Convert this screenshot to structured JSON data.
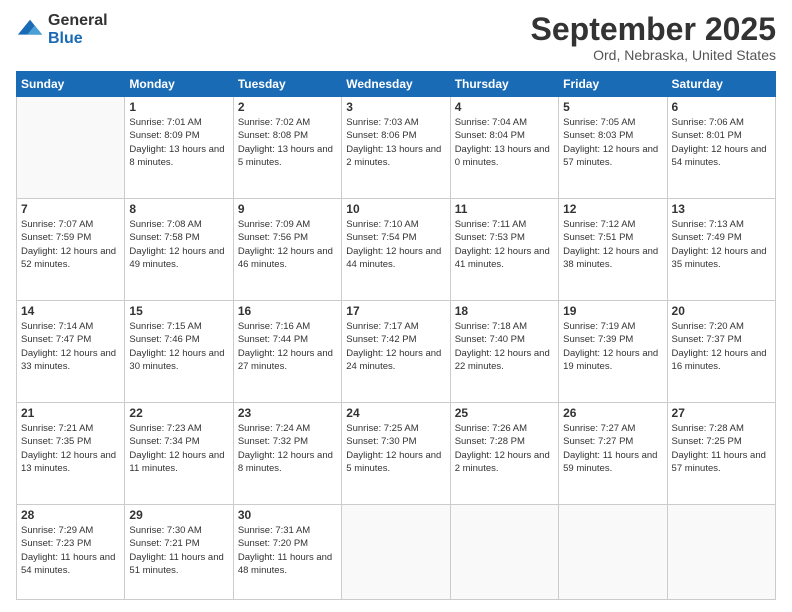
{
  "logo": {
    "general": "General",
    "blue": "Blue"
  },
  "header": {
    "title": "September 2025",
    "subtitle": "Ord, Nebraska, United States"
  },
  "weekdays": [
    "Sunday",
    "Monday",
    "Tuesday",
    "Wednesday",
    "Thursday",
    "Friday",
    "Saturday"
  ],
  "weeks": [
    [
      null,
      {
        "day": 1,
        "sunrise": "7:01 AM",
        "sunset": "8:09 PM",
        "daylight": "13 hours and 8 minutes."
      },
      {
        "day": 2,
        "sunrise": "7:02 AM",
        "sunset": "8:08 PM",
        "daylight": "13 hours and 5 minutes."
      },
      {
        "day": 3,
        "sunrise": "7:03 AM",
        "sunset": "8:06 PM",
        "daylight": "13 hours and 2 minutes."
      },
      {
        "day": 4,
        "sunrise": "7:04 AM",
        "sunset": "8:04 PM",
        "daylight": "13 hours and 0 minutes."
      },
      {
        "day": 5,
        "sunrise": "7:05 AM",
        "sunset": "8:03 PM",
        "daylight": "12 hours and 57 minutes."
      },
      {
        "day": 6,
        "sunrise": "7:06 AM",
        "sunset": "8:01 PM",
        "daylight": "12 hours and 54 minutes."
      }
    ],
    [
      {
        "day": 7,
        "sunrise": "7:07 AM",
        "sunset": "7:59 PM",
        "daylight": "12 hours and 52 minutes."
      },
      {
        "day": 8,
        "sunrise": "7:08 AM",
        "sunset": "7:58 PM",
        "daylight": "12 hours and 49 minutes."
      },
      {
        "day": 9,
        "sunrise": "7:09 AM",
        "sunset": "7:56 PM",
        "daylight": "12 hours and 46 minutes."
      },
      {
        "day": 10,
        "sunrise": "7:10 AM",
        "sunset": "7:54 PM",
        "daylight": "12 hours and 44 minutes."
      },
      {
        "day": 11,
        "sunrise": "7:11 AM",
        "sunset": "7:53 PM",
        "daylight": "12 hours and 41 minutes."
      },
      {
        "day": 12,
        "sunrise": "7:12 AM",
        "sunset": "7:51 PM",
        "daylight": "12 hours and 38 minutes."
      },
      {
        "day": 13,
        "sunrise": "7:13 AM",
        "sunset": "7:49 PM",
        "daylight": "12 hours and 35 minutes."
      }
    ],
    [
      {
        "day": 14,
        "sunrise": "7:14 AM",
        "sunset": "7:47 PM",
        "daylight": "12 hours and 33 minutes."
      },
      {
        "day": 15,
        "sunrise": "7:15 AM",
        "sunset": "7:46 PM",
        "daylight": "12 hours and 30 minutes."
      },
      {
        "day": 16,
        "sunrise": "7:16 AM",
        "sunset": "7:44 PM",
        "daylight": "12 hours and 27 minutes."
      },
      {
        "day": 17,
        "sunrise": "7:17 AM",
        "sunset": "7:42 PM",
        "daylight": "12 hours and 24 minutes."
      },
      {
        "day": 18,
        "sunrise": "7:18 AM",
        "sunset": "7:40 PM",
        "daylight": "12 hours and 22 minutes."
      },
      {
        "day": 19,
        "sunrise": "7:19 AM",
        "sunset": "7:39 PM",
        "daylight": "12 hours and 19 minutes."
      },
      {
        "day": 20,
        "sunrise": "7:20 AM",
        "sunset": "7:37 PM",
        "daylight": "12 hours and 16 minutes."
      }
    ],
    [
      {
        "day": 21,
        "sunrise": "7:21 AM",
        "sunset": "7:35 PM",
        "daylight": "12 hours and 13 minutes."
      },
      {
        "day": 22,
        "sunrise": "7:23 AM",
        "sunset": "7:34 PM",
        "daylight": "12 hours and 11 minutes."
      },
      {
        "day": 23,
        "sunrise": "7:24 AM",
        "sunset": "7:32 PM",
        "daylight": "12 hours and 8 minutes."
      },
      {
        "day": 24,
        "sunrise": "7:25 AM",
        "sunset": "7:30 PM",
        "daylight": "12 hours and 5 minutes."
      },
      {
        "day": 25,
        "sunrise": "7:26 AM",
        "sunset": "7:28 PM",
        "daylight": "12 hours and 2 minutes."
      },
      {
        "day": 26,
        "sunrise": "7:27 AM",
        "sunset": "7:27 PM",
        "daylight": "11 hours and 59 minutes."
      },
      {
        "day": 27,
        "sunrise": "7:28 AM",
        "sunset": "7:25 PM",
        "daylight": "11 hours and 57 minutes."
      }
    ],
    [
      {
        "day": 28,
        "sunrise": "7:29 AM",
        "sunset": "7:23 PM",
        "daylight": "11 hours and 54 minutes."
      },
      {
        "day": 29,
        "sunrise": "7:30 AM",
        "sunset": "7:21 PM",
        "daylight": "11 hours and 51 minutes."
      },
      {
        "day": 30,
        "sunrise": "7:31 AM",
        "sunset": "7:20 PM",
        "daylight": "11 hours and 48 minutes."
      },
      null,
      null,
      null,
      null
    ]
  ]
}
